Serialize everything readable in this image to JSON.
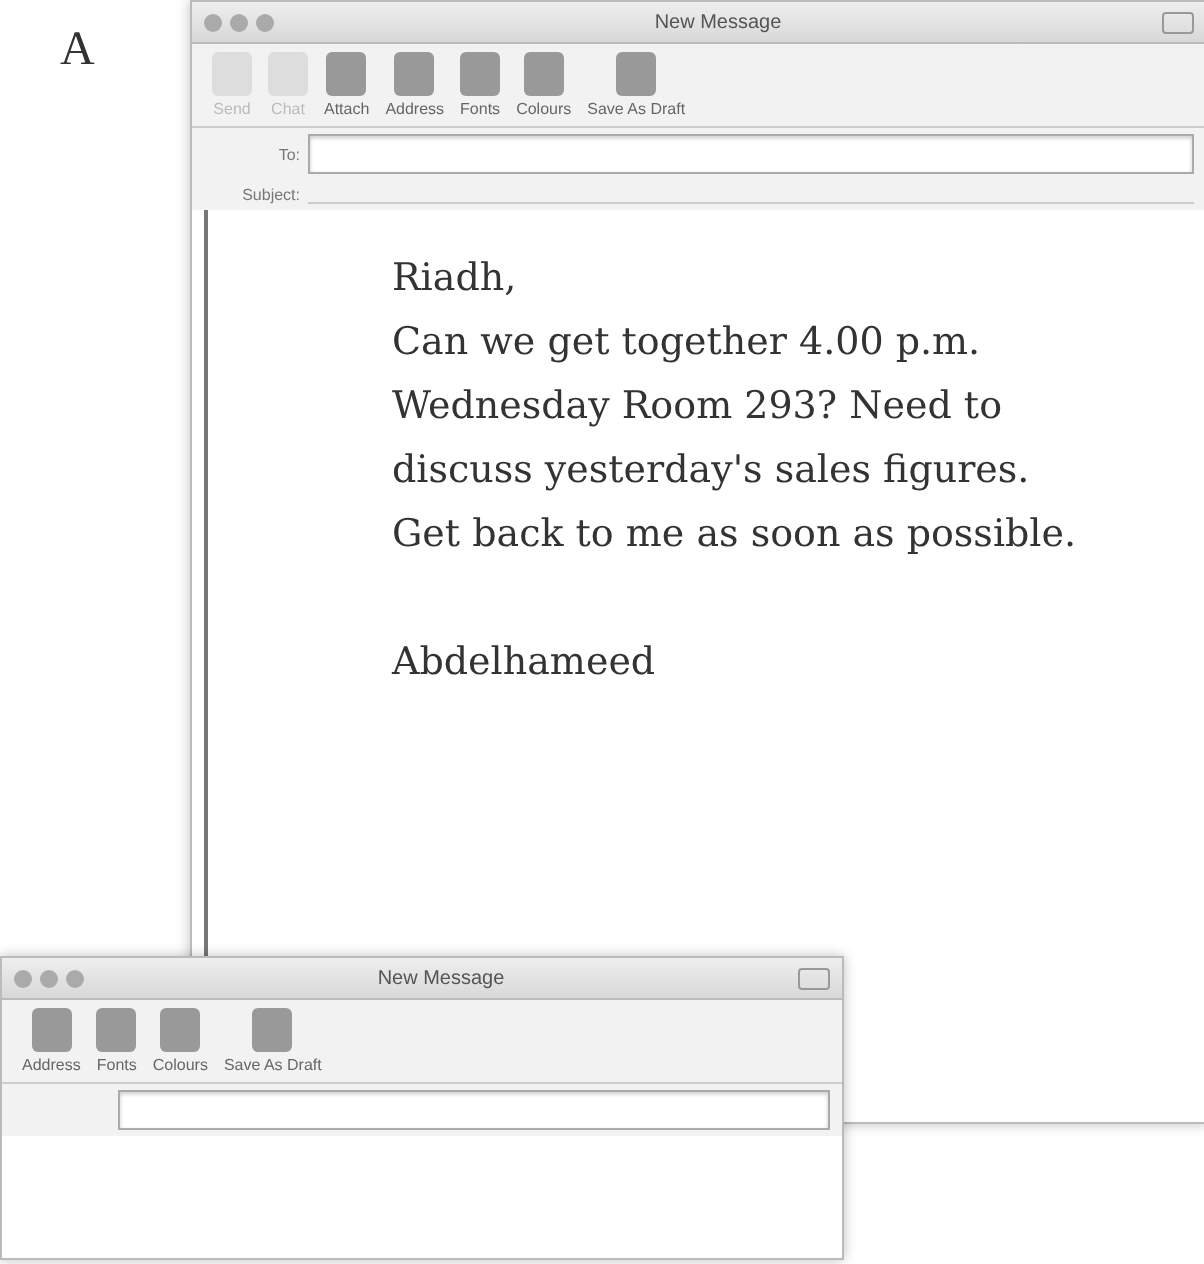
{
  "figure_label": "A",
  "windows": [
    {
      "title": "New Message",
      "toolbar": [
        {
          "label": "Send",
          "disabled": true
        },
        {
          "label": "Chat",
          "disabled": true
        },
        {
          "label": "Attach",
          "disabled": false
        },
        {
          "label": "Address",
          "disabled": false
        },
        {
          "label": "Fonts",
          "disabled": false
        },
        {
          "label": "Colours",
          "disabled": false
        },
        {
          "label": "Save As Draft",
          "disabled": false
        }
      ],
      "fields": [
        {
          "label": "To:",
          "kind": "box"
        },
        {
          "label": "Subject:",
          "kind": "line"
        }
      ],
      "body": [
        "Riadh,",
        "Can we get together 4.00 p.m.",
        "Wednesday Room 293? Need to",
        "discuss yesterday's sales figures.",
        "Get back to me as soon as possible."
      ],
      "signature": "Abdelhameed"
    },
    {
      "title": "New Message",
      "toolbar": [
        {
          "label": "Address",
          "disabled": false
        },
        {
          "label": "Fonts",
          "disabled": false
        },
        {
          "label": "Colours",
          "disabled": false
        },
        {
          "label": "Save As Draft",
          "disabled": false
        }
      ],
      "fields": [
        {
          "kind": "box"
        }
      ]
    }
  ]
}
